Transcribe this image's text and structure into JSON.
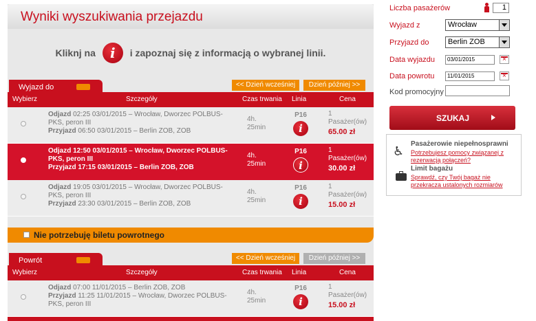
{
  "title": "Wyniki wyszukiwania przejazdu",
  "info": {
    "before": "Kliknj na",
    "icon_glyph": "i",
    "after": "i zapoznaj się z informacją o wybranej linii."
  },
  "outbound": {
    "tab_label": "Wyjazd do",
    "earlier": "<< Dzień wcześniej",
    "later": "Dzień później >>",
    "headers": {
      "choose": "Wybierz",
      "details": "Szczegóły",
      "duration": "Czas trwania",
      "line": "Linia",
      "price": "Cena"
    },
    "rows": [
      {
        "dep": "Odjazd",
        "dep_text": "02:25 03/01/2015 – Wrocław, Dworzec POLBUS-PKS, peron III",
        "arr": "Przyjazd",
        "arr_text": "06:50 03/01/2015 – Berlin ZOB, ZOB",
        "duration": "4h. 25min",
        "line": "P16",
        "pax": "1 Pasażer(ów)",
        "price": "65.00 zł",
        "selected": false
      },
      {
        "dep": "Odjazd",
        "dep_text": "12:50 03/01/2015 – Wrocław, Dworzec POLBUS-PKS, peron III",
        "arr": "Przyjazd",
        "arr_text": "17:15 03/01/2015 – Berlin ZOB, ZOB",
        "duration": "4h. 25min",
        "line": "P16",
        "pax": "1 Pasażer(ów)",
        "price": "30.00 zł",
        "selected": true
      },
      {
        "dep": "Odjazd",
        "dep_text": "19:05 03/01/2015 – Wrocław, Dworzec POLBUS-PKS, peron III",
        "arr": "Przyjazd",
        "arr_text": "23:30 03/01/2015 – Berlin ZOB, ZOB",
        "duration": "4h. 25min",
        "line": "P16",
        "pax": "1 Pasażer(ów)",
        "price": "15.00 zł",
        "selected": false
      }
    ]
  },
  "no_return": "Nie potrzebuję biletu powrotnego",
  "return": {
    "tab_label": "Powrót",
    "earlier": "<< Dzień wcześniej",
    "later": "Dzień później >>",
    "headers": {
      "choose": "Wybierz",
      "details": "Szczegóły",
      "duration": "Czas trwania",
      "line": "Linia",
      "price": "Cena"
    },
    "rows": [
      {
        "dep": "Odjazd",
        "dep_text": "07:00 11/01/2015 – Berlin ZOB, ZOB",
        "arr": "Przyjazd",
        "arr_text": "11:25 11/01/2015 – Wrocław, Dworzec POLBUS-PKS, peron III",
        "duration": "4h. 25min",
        "line": "P16",
        "pax": "1 Pasażer(ów)",
        "price": "15.00 zł",
        "selected": false
      }
    ]
  },
  "form": {
    "pax_label": "Liczba pasażerów",
    "pax_value": "1",
    "from_label": "Wyjazd z",
    "from_value": "Wrocław",
    "to_label": "Przyjazd do",
    "to_value": "Berlin ZOB",
    "dep_date_label": "Data wyjazdu",
    "dep_date": "03/01/2015",
    "ret_date_label": "Data powrotu",
    "ret_date": "11/01/2015",
    "promo_label": "Kod promocyjny",
    "promo_value": "",
    "search": "SZUKAJ"
  },
  "side_info": {
    "disabled_title": "Pasażerowie niepełnosprawni",
    "disabled_link": "Potrzebujesz pomocy związanej z rezerwacją połączeń?",
    "baggage_title": "Limit bagażu",
    "baggage_link": "Sprawdź, czy Twój bagaż nie przekracza ustalonych rozmiarów"
  },
  "colors": {
    "brand_red": "#c8101e",
    "accent_orange": "#f08a00"
  },
  "icons": {
    "info": "info-icon",
    "bus": "bus-icon",
    "person": "person-icon",
    "wheelchair": "wheelchair-icon",
    "luggage": "luggage-icon",
    "calendar": "calendar-icon"
  }
}
